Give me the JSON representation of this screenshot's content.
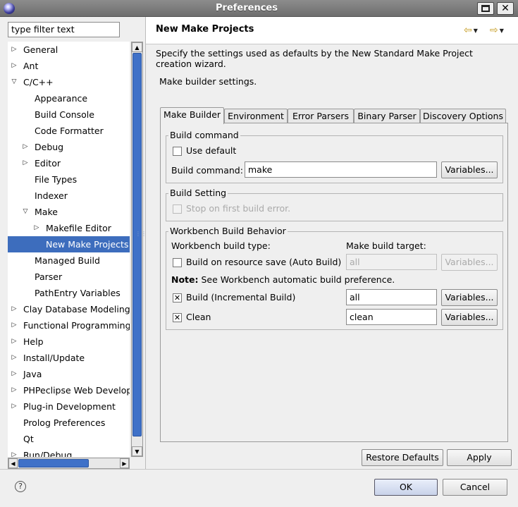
{
  "window": {
    "title": "Preferences"
  },
  "filter": {
    "value": "type filter text"
  },
  "tree": {
    "items": [
      {
        "label": "General",
        "indent": 0,
        "toggle": "collapsed"
      },
      {
        "label": "Ant",
        "indent": 0,
        "toggle": "collapsed"
      },
      {
        "label": "C/C++",
        "indent": 0,
        "toggle": "expanded"
      },
      {
        "label": "Appearance",
        "indent": 1,
        "toggle": "none"
      },
      {
        "label": "Build Console",
        "indent": 1,
        "toggle": "none"
      },
      {
        "label": "Code Formatter",
        "indent": 1,
        "toggle": "none"
      },
      {
        "label": "Debug",
        "indent": 1,
        "toggle": "collapsed"
      },
      {
        "label": "Editor",
        "indent": 1,
        "toggle": "collapsed"
      },
      {
        "label": "File Types",
        "indent": 1,
        "toggle": "none"
      },
      {
        "label": "Indexer",
        "indent": 1,
        "toggle": "none"
      },
      {
        "label": "Make",
        "indent": 1,
        "toggle": "expanded"
      },
      {
        "label": "Makefile Editor",
        "indent": 2,
        "toggle": "collapsed"
      },
      {
        "label": "New Make Projects",
        "indent": 2,
        "toggle": "none",
        "selected": true
      },
      {
        "label": "Managed Build",
        "indent": 1,
        "toggle": "none"
      },
      {
        "label": "Parser",
        "indent": 1,
        "toggle": "none"
      },
      {
        "label": "PathEntry Variables",
        "indent": 1,
        "toggle": "none"
      },
      {
        "label": "Clay Database Modeling",
        "indent": 0,
        "toggle": "collapsed"
      },
      {
        "label": "Functional Programming",
        "indent": 0,
        "toggle": "collapsed"
      },
      {
        "label": "Help",
        "indent": 0,
        "toggle": "collapsed"
      },
      {
        "label": "Install/Update",
        "indent": 0,
        "toggle": "collapsed"
      },
      {
        "label": "Java",
        "indent": 0,
        "toggle": "collapsed"
      },
      {
        "label": "PHPeclipse Web Development",
        "indent": 0,
        "toggle": "collapsed"
      },
      {
        "label": "Plug-in Development",
        "indent": 0,
        "toggle": "collapsed"
      },
      {
        "label": "Prolog Preferences",
        "indent": 0,
        "toggle": "none"
      },
      {
        "label": "Qt",
        "indent": 0,
        "toggle": "none"
      },
      {
        "label": "Run/Debug",
        "indent": 0,
        "toggle": "collapsed"
      }
    ]
  },
  "page": {
    "title": "New Make Projects",
    "description": "Specify the settings used as defaults by the New Standard Make Project creation wizard.",
    "subtitle": "Make builder settings."
  },
  "tabs": [
    "Make Builder",
    "Environment",
    "Error Parsers",
    "Binary Parser",
    "Discovery Options"
  ],
  "build_command": {
    "group_title": "Build command",
    "use_default_label": "Use default",
    "use_default_checked": false,
    "field_label": "Build command:",
    "value": "make",
    "variables_label": "Variables..."
  },
  "build_setting": {
    "group_title": "Build Setting",
    "stop_label": "Stop on first build error."
  },
  "workbench": {
    "group_title": "Workbench Build Behavior",
    "type_label": "Workbench build type:",
    "target_label": "Make build target:",
    "auto_label": "Build on resource save (Auto Build)",
    "auto_value": "all",
    "note_bold": "Note:",
    "note_text": "See Workbench automatic build preference.",
    "incremental_label": "Build (Incremental Build)",
    "incremental_value": "all",
    "clean_label": "Clean",
    "clean_value": "clean",
    "variables_label": "Variables..."
  },
  "buttons": {
    "restore_defaults": "Restore Defaults",
    "apply": "Apply",
    "ok": "OK",
    "cancel": "Cancel"
  }
}
